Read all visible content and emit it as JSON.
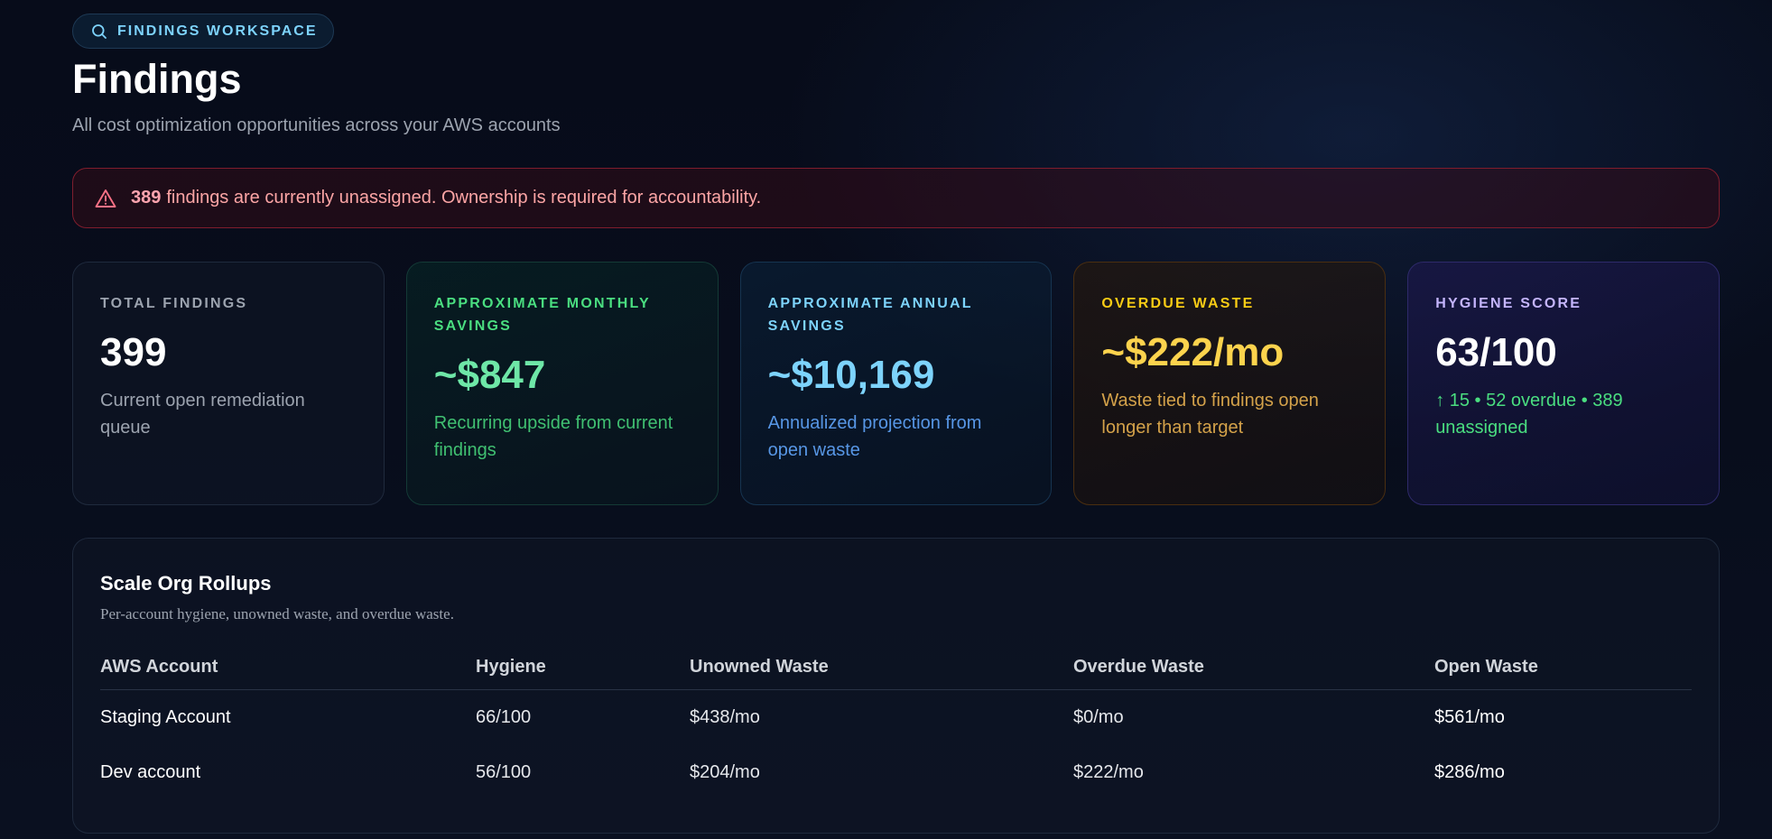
{
  "header": {
    "badge_label": "FINDINGS WORKSPACE",
    "badge_icon": "search-icon",
    "title": "Findings",
    "subtitle": "All cost optimization opportunities across your AWS accounts"
  },
  "alert": {
    "icon": "warning-triangle-icon",
    "count": "389",
    "message": "findings are currently unassigned. Ownership is required for accountability.",
    "color": "#fca5a5"
  },
  "cards": {
    "total": {
      "label": "TOTAL FINDINGS",
      "value": "399",
      "description": "Current open remediation queue"
    },
    "monthly": {
      "label": "APPROXIMATE MONTHLY SAVINGS",
      "value": "~$847",
      "description": "Recurring upside from current findings",
      "color": "#6ee7a7"
    },
    "annual": {
      "label": "APPROXIMATE ANNUAL SAVINGS",
      "value": "~$10,169",
      "description": "Annualized projection from open waste",
      "color": "#7dd3fc"
    },
    "overdue": {
      "label": "OVERDUE WASTE",
      "value": "~$222/mo",
      "description": "Waste tied to findings open longer than target",
      "color": "#fcd34d"
    },
    "hygiene": {
      "label": "HYGIENE SCORE",
      "value": "63/100",
      "description": "↑ 15 • 52 overdue • 389 unassigned",
      "color": "#c4b5fd"
    }
  },
  "rollups": {
    "title": "Scale Org Rollups",
    "subtitle": "Per-account hygiene, unowned waste, and overdue waste.",
    "columns": [
      "AWS Account",
      "Hygiene",
      "Unowned Waste",
      "Overdue Waste",
      "Open Waste"
    ],
    "rows": [
      [
        "Staging Account",
        "66/100",
        "$438/mo",
        "$0/mo",
        "$561/mo"
      ],
      [
        "Dev account",
        "56/100",
        "$204/mo",
        "$222/mo",
        "$286/mo"
      ]
    ]
  }
}
